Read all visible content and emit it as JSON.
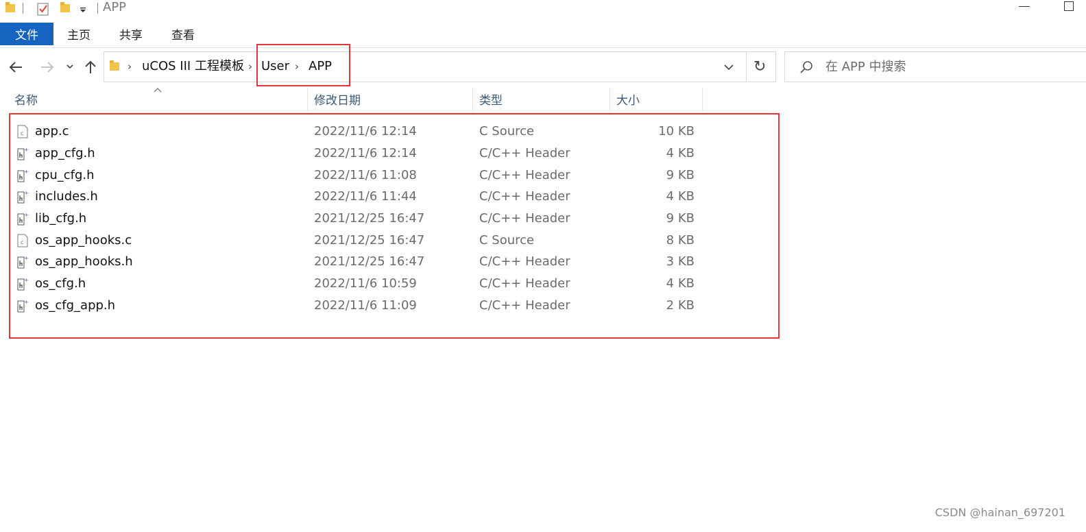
{
  "window": {
    "title": "APP"
  },
  "ribbon": {
    "tabs": [
      "文件",
      "主页",
      "共享",
      "查看"
    ]
  },
  "address": {
    "crumbs": [
      "uCOS III 工程模板",
      "User",
      "APP"
    ]
  },
  "search": {
    "placeholder": "在 APP 中搜索"
  },
  "columns": {
    "name": "名称",
    "date": "修改日期",
    "type": "类型",
    "size": "大小"
  },
  "files": [
    {
      "name": "app.c",
      "date": "2022/11/6 12:14",
      "type": "C Source",
      "size": "10 KB",
      "icon": "c-source-file-icon"
    },
    {
      "name": "app_cfg.h",
      "date": "2022/11/6 12:14",
      "type": "C/C++ Header",
      "size": "4 KB",
      "icon": "header-file-icon"
    },
    {
      "name": "cpu_cfg.h",
      "date": "2022/11/6 11:08",
      "type": "C/C++ Header",
      "size": "9 KB",
      "icon": "header-file-icon"
    },
    {
      "name": "includes.h",
      "date": "2022/11/6 11:44",
      "type": "C/C++ Header",
      "size": "4 KB",
      "icon": "header-file-icon"
    },
    {
      "name": "lib_cfg.h",
      "date": "2021/12/25 16:47",
      "type": "C/C++ Header",
      "size": "9 KB",
      "icon": "header-file-icon"
    },
    {
      "name": "os_app_hooks.c",
      "date": "2021/12/25 16:47",
      "type": "C Source",
      "size": "8 KB",
      "icon": "c-source-file-icon"
    },
    {
      "name": "os_app_hooks.h",
      "date": "2021/12/25 16:47",
      "type": "C/C++ Header",
      "size": "3 KB",
      "icon": "header-file-icon"
    },
    {
      "name": "os_cfg.h",
      "date": "2022/11/6 10:59",
      "type": "C/C++ Header",
      "size": "4 KB",
      "icon": "header-file-icon"
    },
    {
      "name": "os_cfg_app.h",
      "date": "2022/11/6 11:09",
      "type": "C/C++ Header",
      "size": "2 KB",
      "icon": "header-file-icon"
    }
  ],
  "watermark": "CSDN @hainan_697201",
  "colors": {
    "accent": "#1565c0",
    "annotation": "#e8353b",
    "header_text": "#3a5a7a"
  }
}
